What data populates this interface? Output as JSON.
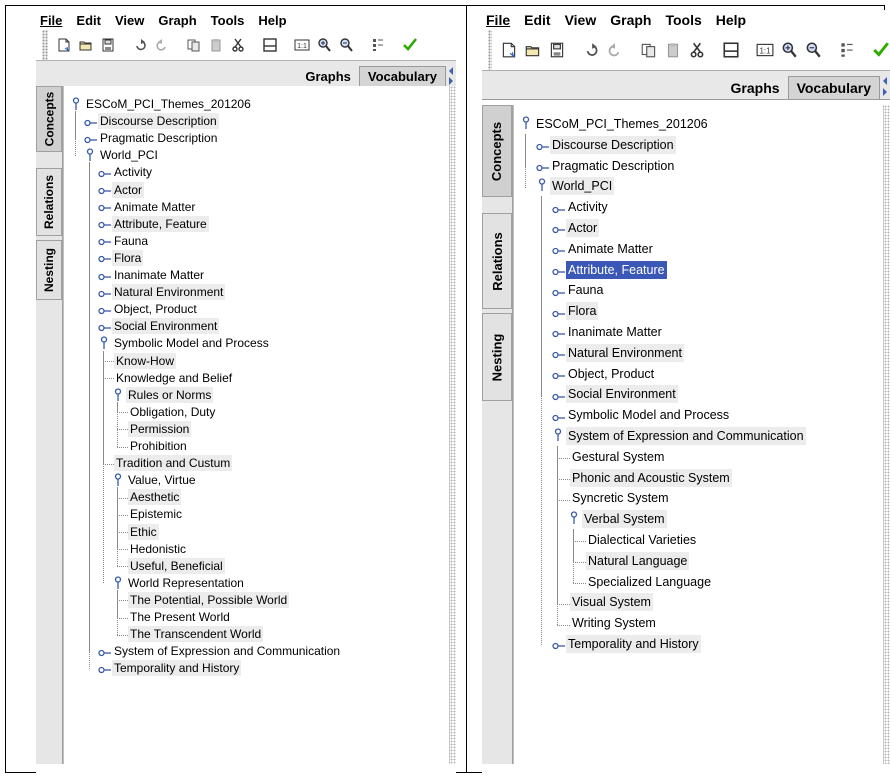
{
  "menu": [
    "File",
    "Edit",
    "View",
    "Graph",
    "Tools",
    "Help"
  ],
  "toolbar_icons": [
    "new-document-icon",
    "open-folder-icon",
    "save-icon",
    "undo-icon",
    "redo-icon",
    "copy-icon",
    "paste-icon",
    "cut-icon",
    "fit-window-icon",
    "zoom-actual-icon",
    "zoom-in-icon",
    "zoom-out-icon",
    "layout-icon",
    "check-icon"
  ],
  "tabs": [
    "Graphs",
    "Vocabulary"
  ],
  "vertical_tabs": [
    "Concepts",
    "Relations",
    "Nesting"
  ],
  "colors": {
    "selection": "#3b58b7",
    "highlight": "#ececec",
    "check": "#2faa00",
    "tab_bg": "#e8e8e8"
  },
  "left_panel": {
    "tree": [
      {
        "label": "ESCoM_PCI_Themes_201206",
        "depth": 0,
        "state": "expanded"
      },
      {
        "label": "Discourse Description",
        "depth": 1,
        "state": "collapsed",
        "highlight": true
      },
      {
        "label": "Pragmatic Description",
        "depth": 1,
        "state": "collapsed"
      },
      {
        "label": "World_PCI",
        "depth": 1,
        "state": "expanded"
      },
      {
        "label": "Activity",
        "depth": 2,
        "state": "collapsed"
      },
      {
        "label": "Actor",
        "depth": 2,
        "state": "collapsed",
        "highlight": true
      },
      {
        "label": "Animate Matter",
        "depth": 2,
        "state": "collapsed"
      },
      {
        "label": "Attribute, Feature",
        "depth": 2,
        "state": "collapsed",
        "highlight": true
      },
      {
        "label": "Fauna",
        "depth": 2,
        "state": "collapsed"
      },
      {
        "label": "Flora",
        "depth": 2,
        "state": "collapsed",
        "highlight": true
      },
      {
        "label": "Inanimate Matter",
        "depth": 2,
        "state": "collapsed"
      },
      {
        "label": "Natural Environment",
        "depth": 2,
        "state": "collapsed",
        "highlight": true
      },
      {
        "label": "Object, Product",
        "depth": 2,
        "state": "collapsed"
      },
      {
        "label": "Social Environment",
        "depth": 2,
        "state": "collapsed",
        "highlight": true
      },
      {
        "label": "Symbolic Model and Process",
        "depth": 2,
        "state": "expanded"
      },
      {
        "label": "Know-How",
        "depth": 3,
        "state": "leaf",
        "highlight": true
      },
      {
        "label": "Knowledge and Belief",
        "depth": 3,
        "state": "leaf"
      },
      {
        "label": "Rules or Norms",
        "depth": 3,
        "state": "expanded",
        "highlight": true
      },
      {
        "label": "Obligation, Duty",
        "depth": 4,
        "state": "leaf"
      },
      {
        "label": "Permission",
        "depth": 4,
        "state": "leaf",
        "highlight": true
      },
      {
        "label": "Prohibition",
        "depth": 4,
        "state": "leaf"
      },
      {
        "label": "Tradition and Custum",
        "depth": 3,
        "state": "leaf",
        "highlight": true
      },
      {
        "label": "Value, Virtue",
        "depth": 3,
        "state": "expanded"
      },
      {
        "label": "Aesthetic",
        "depth": 4,
        "state": "leaf",
        "highlight": true
      },
      {
        "label": "Epistemic",
        "depth": 4,
        "state": "leaf"
      },
      {
        "label": "Ethic",
        "depth": 4,
        "state": "leaf",
        "highlight": true
      },
      {
        "label": "Hedonistic",
        "depth": 4,
        "state": "leaf"
      },
      {
        "label": "Useful, Beneficial",
        "depth": 4,
        "state": "leaf",
        "highlight": true
      },
      {
        "label": "World Representation",
        "depth": 3,
        "state": "expanded"
      },
      {
        "label": "The Potential, Possible World",
        "depth": 4,
        "state": "leaf",
        "highlight": true
      },
      {
        "label": "The Present World",
        "depth": 4,
        "state": "leaf"
      },
      {
        "label": "The Transcendent World",
        "depth": 4,
        "state": "leaf",
        "highlight": true
      },
      {
        "label": "System of Expression and Communication",
        "depth": 2,
        "state": "collapsed"
      },
      {
        "label": "Temporality and History",
        "depth": 2,
        "state": "collapsed",
        "highlight": true
      }
    ]
  },
  "right_panel": {
    "tree": [
      {
        "label": "ESCoM_PCI_Themes_201206",
        "depth": 0,
        "state": "expanded"
      },
      {
        "label": "Discourse Description",
        "depth": 1,
        "state": "collapsed",
        "highlight": true
      },
      {
        "label": "Pragmatic Description",
        "depth": 1,
        "state": "collapsed"
      },
      {
        "label": "World_PCI",
        "depth": 1,
        "state": "expanded",
        "highlight": true
      },
      {
        "label": "Activity",
        "depth": 2,
        "state": "collapsed"
      },
      {
        "label": "Actor",
        "depth": 2,
        "state": "collapsed",
        "highlight": true
      },
      {
        "label": "Animate Matter",
        "depth": 2,
        "state": "collapsed"
      },
      {
        "label": "Attribute, Feature",
        "depth": 2,
        "state": "collapsed",
        "selected": true
      },
      {
        "label": "Fauna",
        "depth": 2,
        "state": "collapsed"
      },
      {
        "label": "Flora",
        "depth": 2,
        "state": "collapsed",
        "highlight": true
      },
      {
        "label": "Inanimate Matter",
        "depth": 2,
        "state": "collapsed"
      },
      {
        "label": "Natural Environment",
        "depth": 2,
        "state": "collapsed",
        "highlight": true
      },
      {
        "label": "Object, Product",
        "depth": 2,
        "state": "collapsed"
      },
      {
        "label": "Social Environment",
        "depth": 2,
        "state": "collapsed",
        "highlight": true
      },
      {
        "label": "Symbolic Model and Process",
        "depth": 2,
        "state": "collapsed"
      },
      {
        "label": "System of Expression and Communication",
        "depth": 2,
        "state": "expanded",
        "highlight": true
      },
      {
        "label": "Gestural System",
        "depth": 3,
        "state": "leaf"
      },
      {
        "label": "Phonic and Acoustic System",
        "depth": 3,
        "state": "leaf",
        "highlight": true
      },
      {
        "label": "Syncretic System",
        "depth": 3,
        "state": "leaf"
      },
      {
        "label": "Verbal System",
        "depth": 3,
        "state": "expanded",
        "highlight": true
      },
      {
        "label": "Dialectical Varieties",
        "depth": 4,
        "state": "leaf"
      },
      {
        "label": "Natural Language",
        "depth": 4,
        "state": "leaf",
        "highlight": true
      },
      {
        "label": "Specialized Language",
        "depth": 4,
        "state": "leaf"
      },
      {
        "label": "Visual System",
        "depth": 3,
        "state": "leaf",
        "highlight": true
      },
      {
        "label": "Writing System",
        "depth": 3,
        "state": "leaf"
      },
      {
        "label": "Temporality and History",
        "depth": 2,
        "state": "collapsed",
        "highlight": true
      }
    ]
  }
}
